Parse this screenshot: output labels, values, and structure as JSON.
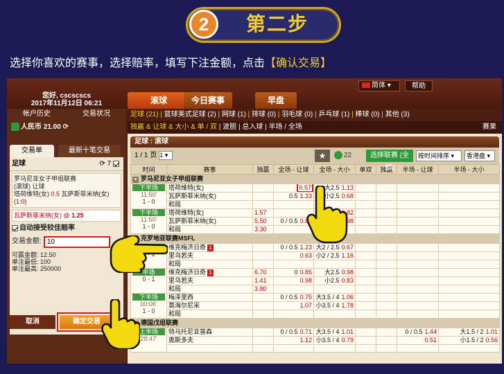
{
  "header": {
    "step_number": "2",
    "step_title": "第二步"
  },
  "instruction": {
    "text": "选择你喜欢的赛事，选择赔率，填写下注金额，点击",
    "highlight": "【确认交易】"
  },
  "topbar": {
    "user_name": "您好, cscscscs",
    "datetime": "2017年11月12日 06:21",
    "tabs": [
      "滚球",
      "今日赛事",
      "早盘"
    ],
    "language": "简体",
    "help": "帮助"
  },
  "left": {
    "links": [
      "帐户历史",
      "交易状况"
    ],
    "balance": "人民币 21.00",
    "slip_tabs": [
      "交易单",
      "最新十笔交易"
    ],
    "sport": "足球",
    "count": "7",
    "bet_league": "罗马尼亚女子甲组联赛",
    "bet_type": "(滚球) 让球",
    "bet_home": "塔荷维特(女)",
    "bet_line": "0.5",
    "bet_away": "瓦萨斯菲米纳(女)",
    "bet_score": "(1:0)",
    "selection": "瓦萨斯菲米纳(女)",
    "selection_odds": "1.25",
    "auto_accept": "自动接受较佳赔率",
    "amount_label": "交易金额:",
    "amount_value": "10",
    "winnable_label": "可赢金额:",
    "winnable_value": "12.50",
    "min_label": "单注最低:",
    "min_value": "100",
    "max_label": "单注最高:",
    "max_value": "250000",
    "cancel": "取消",
    "confirm": "确定交易"
  },
  "main": {
    "sports_bar": [
      "足球 (21)",
      "篮球美式足球 (2)",
      "网球 (1)",
      "排球 (0)",
      "羽毛球 (0)",
      "乒乓球 (1)",
      "棒球 (0)",
      "其他 (3)"
    ],
    "sub_bar": [
      "独赢 & 让球 & 大小 & 单 / 双",
      "波胆",
      "总入球",
      "半场 / 全场"
    ],
    "sub_right": "赛果",
    "panel_title": "足球 : 滚球",
    "page": "1 / 1 页",
    "page_sel": "1",
    "refresh_count": "22",
    "league_select": "选择联赛 (全部)",
    "sort": "按时间排序",
    "odds_type": "香港盘",
    "columns": [
      "时间",
      "赛事",
      "独赢",
      "全场 - 让球",
      "全场 - 大小",
      "单双",
      "独赢",
      "半场 - 让球",
      "半场 - 大小"
    ]
  },
  "leagues": [
    {
      "name": "罗马尼亚女子甲组联赛",
      "matches": [
        {
          "status": "下半场",
          "time": "11:50'",
          "score": "1 - 0",
          "home": "塔荷维特(女)",
          "away": "瓦萨斯菲米纳(女)",
          "draw": "和局",
          "red": "",
          "ml": [
            "",
            "",
            ""
          ],
          "hdp": [
            [
              "",
              "0.57"
            ],
            [
              "0.5",
              "1.33"
            ]
          ],
          "ou": [
            [
              "大2.5",
              "1.13"
            ],
            [
              "小2.5",
              "0.68"
            ]
          ],
          "hhdp": [
            [
              "",
              ""
            ],
            [
              "",
              ""
            ]
          ],
          "hou": [
            [
              "",
              ""
            ],
            [
              "",
              ""
            ]
          ]
        },
        {
          "status": "下半场",
          "time": "11:50'",
          "score": "1 - 0",
          "home": "塔荷维特(女)",
          "away": "瓦萨斯菲米纳(女)",
          "draw": "和局",
          "red": "",
          "ml": [
            "1.57",
            "5.50",
            "3.30"
          ],
          "hdp": [
            [
              "",
              ""
            ],
            [
              "0 / 0.5",
              "0.82"
            ]
          ],
          "ou": [
            [
              "大2.5",
              "0.82"
            ],
            [
              "小2.5",
              "0.98"
            ]
          ],
          "hhdp": [
            [
              "",
              ""
            ],
            [
              "",
              ""
            ]
          ],
          "hou": [
            [
              "",
              ""
            ],
            [
              "",
              ""
            ]
          ]
        }
      ]
    },
    {
      "name": "克罗地亚联赛MSFL",
      "matches": [
        {
          "status": "下半场",
          "time": "",
          "score": "0 - 1",
          "home": "维克梅济日奇",
          "away": "里乌若夫",
          "draw": "和局",
          "red": "1",
          "ml": [
            "",
            "",
            ""
          ],
          "hdp": [
            [
              "0 / 0.5",
              "1.23"
            ],
            [
              "",
              "0.63"
            ]
          ],
          "ou": [
            [
              "大2 / 2.5",
              "0.67"
            ],
            [
              "小2 / 2.5",
              "1.16"
            ]
          ],
          "hhdp": [
            [
              "",
              ""
            ],
            [
              "",
              ""
            ]
          ],
          "hou": [
            [
              "",
              ""
            ],
            [
              "",
              ""
            ]
          ]
        },
        {
          "status": "半场",
          "time": "",
          "score": "0 - 1",
          "home": "维克梅济日奇",
          "away": "里乌若夫",
          "draw": "和局",
          "red": "1",
          "ml": [
            "6.70",
            "1.41",
            "3.80"
          ],
          "hdp": [
            [
              "0",
              "0.85"
            ],
            [
              "",
              "0.98"
            ]
          ],
          "ou": [
            [
              "大2.5",
              "0.98"
            ],
            [
              "小2.5",
              "0.83"
            ]
          ],
          "hhdp": [
            [
              "",
              ""
            ],
            [
              "",
              ""
            ]
          ],
          "hou": [
            [
              "",
              ""
            ],
            [
              "",
              ""
            ]
          ]
        },
        {
          "status": "下半场",
          "time": "00:06'",
          "score": "1 - 0",
          "home": "梅泽里西",
          "away": "莫海尔尼采",
          "draw": "和局",
          "red": "",
          "ml": [
            "",
            "",
            ""
          ],
          "hdp": [
            [
              "0 / 0.5",
              "0.75"
            ],
            [
              "",
              "1.07"
            ]
          ],
          "ou": [
            [
              "大3.5 / 4",
              "1.06"
            ],
            [
              "小3.5 / 4",
              "1.78"
            ]
          ],
          "hhdp": [
            [
              "",
              ""
            ],
            [
              "",
              ""
            ]
          ],
          "hou": [
            [
              "",
              ""
            ],
            [
              "",
              ""
            ]
          ]
        }
      ]
    },
    {
      "name": "德国戊组联赛",
      "matches": [
        {
          "status": "上半场",
          "time": "28:47'",
          "score": "",
          "home": "特马托尼亚普森",
          "away": "奥斯多夫",
          "draw": "",
          "red": "",
          "ml": [
            "",
            "",
            ""
          ],
          "hdp": [
            [
              "0 / 0.5",
              "0.71"
            ],
            [
              "",
              "1.12"
            ]
          ],
          "ou": [
            [
              "大3.5 / 4",
              "1.01"
            ],
            [
              "小3.5 / 4",
              "0.79"
            ]
          ],
          "hhdp": [
            [
              "0 / 0.5",
              "1.44"
            ],
            [
              "",
              "0.51"
            ]
          ],
          "hou": [
            [
              "大1.5 / 2",
              "1.01"
            ],
            [
              "小1.5 / 2",
              "0.56"
            ]
          ]
        }
      ]
    }
  ],
  "colors": {
    "background": "#1b1a55",
    "accent": "#f3cd2c",
    "step_circle": "#e8862a",
    "highlight_box": "#d21a1a",
    "status_green": "#3f9a3f"
  }
}
